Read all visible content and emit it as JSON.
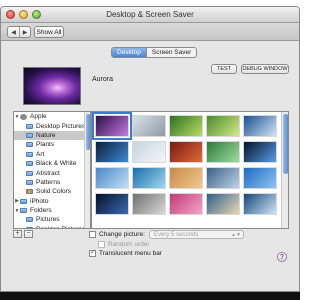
{
  "window": {
    "title": "Desktop & Screen Saver",
    "show_all_label": "Show All"
  },
  "tabs": [
    {
      "label": "Desktop",
      "active": true
    },
    {
      "label": "Screen Saver",
      "active": false
    }
  ],
  "buttons": {
    "test_label": "TEST",
    "debug_label": "DEBUG WINDOW"
  },
  "current_picture": {
    "name": "Aurora"
  },
  "sidebar": {
    "items": [
      {
        "label": "Apple",
        "disclosure": "open",
        "icon": "apple-icon",
        "selected": false
      },
      {
        "label": "Desktop Pictures",
        "icon": "folder-icon",
        "selected": false
      },
      {
        "label": "Nature",
        "icon": "folder-icon",
        "selected": true
      },
      {
        "label": "Plants",
        "icon": "folder-icon",
        "selected": false
      },
      {
        "label": "Art",
        "icon": "folder-icon",
        "selected": false
      },
      {
        "label": "Black & White",
        "icon": "folder-icon",
        "selected": false
      },
      {
        "label": "Abstract",
        "icon": "folder-icon",
        "selected": false
      },
      {
        "label": "Patterns",
        "icon": "folder-icon",
        "selected": false
      },
      {
        "label": "Solid Colors",
        "icon": "solid-colors-icon",
        "selected": false
      },
      {
        "label": "iPhoto",
        "disclosure": "closed",
        "icon": "iphoto-icon",
        "selected": false
      },
      {
        "label": "Folders",
        "disclosure": "open",
        "icon": "folder-icon",
        "selected": false
      },
      {
        "label": "Pictures",
        "icon": "folder-icon",
        "selected": false
      },
      {
        "label": "Desktop Pictures",
        "icon": "folder-icon",
        "selected": false
      }
    ],
    "add_label": "+",
    "remove_label": "−"
  },
  "thumbnails": [
    {
      "name": "aurora-thumb",
      "colors": [
        "#2a0f4a",
        "#c77be0"
      ],
      "selected": true
    },
    {
      "name": "forest-thumb",
      "colors": [
        "#d8e1e9",
        "#8e9ba6"
      ]
    },
    {
      "name": "leaf-thumb",
      "colors": [
        "#2f6f24",
        "#b7dd63"
      ]
    },
    {
      "name": "grass-thumb",
      "colors": [
        "#4c8b2a",
        "#d4ea8a"
      ]
    },
    {
      "name": "wave-thumb",
      "colors": [
        "#1d4f8f",
        "#cfe3f6"
      ]
    },
    {
      "name": "earth-thumb",
      "colors": [
        "#0a1f3b",
        "#3f8ad6"
      ]
    },
    {
      "name": "snow-thumb",
      "colors": [
        "#c7d3df",
        "#f3f6f9"
      ]
    },
    {
      "name": "red-leaf-thumb",
      "colors": [
        "#7a1a10",
        "#e06a3a"
      ]
    },
    {
      "name": "green-leaf-thumb",
      "colors": [
        "#2d7a3a",
        "#9fdca1"
      ]
    },
    {
      "name": "earth2-thumb",
      "colors": [
        "#03132a",
        "#5a9ee3"
      ]
    },
    {
      "name": "sky-thumb",
      "colors": [
        "#4a86c7",
        "#bfe0f7"
      ]
    },
    {
      "name": "ocean-thumb",
      "colors": [
        "#1a6ea8",
        "#9ed7f1"
      ]
    },
    {
      "name": "dunes-thumb",
      "colors": [
        "#c98a4a",
        "#f0c98f"
      ]
    },
    {
      "name": "lake-thumb",
      "colors": [
        "#3b5f86",
        "#bcd3e7"
      ]
    },
    {
      "name": "blue-sky-thumb",
      "colors": [
        "#1f6bc3",
        "#8cc3f0"
      ]
    },
    {
      "name": "galaxy-thumb",
      "colors": [
        "#05102a",
        "#3a6bb0"
      ]
    },
    {
      "name": "pebbles-thumb",
      "colors": [
        "#6f6f6f",
        "#d9d9d9"
      ]
    },
    {
      "name": "pink-thumb",
      "colors": [
        "#c23a76",
        "#f3a5c8"
      ]
    },
    {
      "name": "coast-thumb",
      "colors": [
        "#2e5f8c",
        "#e9d7b3"
      ]
    },
    {
      "name": "iceberg-thumb",
      "colors": [
        "#15467a",
        "#cfe5f6"
      ]
    }
  ],
  "options": {
    "change_picture_label": "Change picture:",
    "change_picture_checked": false,
    "interval_value": "Every 5 seconds",
    "random_order_label": "Random order",
    "random_order_checked": false,
    "translucent_label": "Translucent menu bar",
    "translucent_checked": true
  },
  "help_label": "?"
}
